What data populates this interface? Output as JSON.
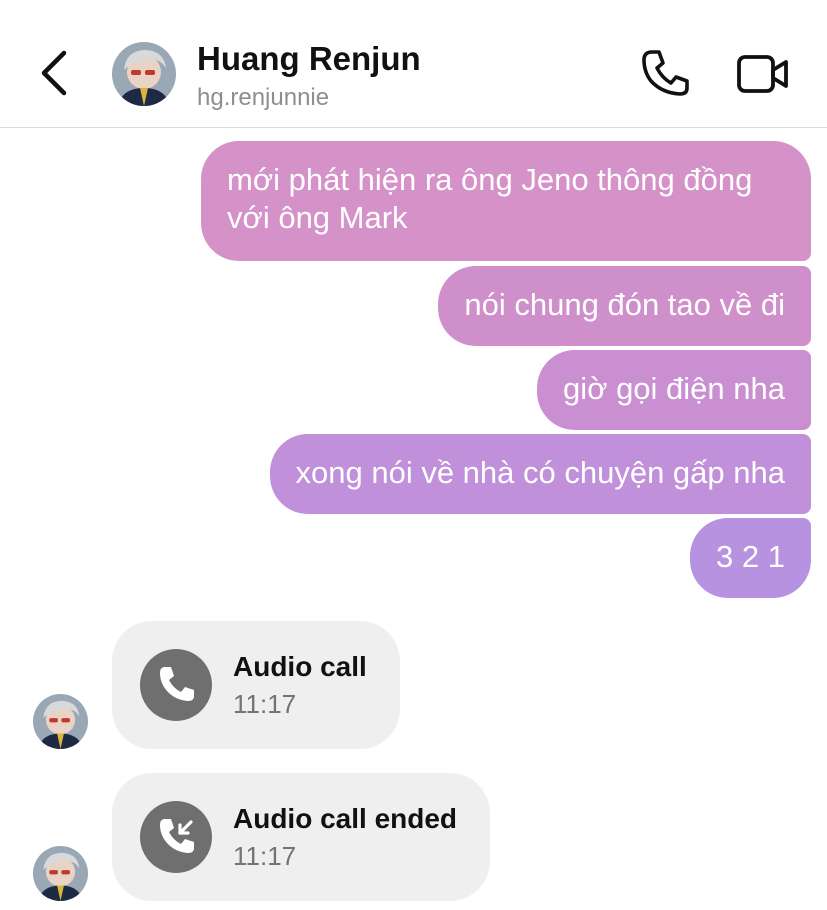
{
  "header": {
    "contact_name": "Huang Renjun",
    "contact_handle": "hg.renjunnie",
    "icons": {
      "back": "chevron-left-icon",
      "call": "phone-icon",
      "video": "video-camera-icon"
    }
  },
  "messages": {
    "outgoing": [
      {
        "line1": "mới phát hiện ra ông Jeno thông đồng",
        "line2": "với ông Mark"
      },
      {
        "text": "nói chung đón tao về đi"
      },
      {
        "text": "giờ gọi điện nha"
      },
      {
        "text": "xong nói về nhà có chuyện gấp nha"
      },
      {
        "text": "3 2 1"
      }
    ],
    "calls": [
      {
        "title": "Audio call",
        "time": "11:17",
        "icon": "phone-icon"
      },
      {
        "title": "Audio call ended",
        "time": "11:17",
        "icon": "phone-incoming-arrow-icon"
      }
    ]
  },
  "colors": {
    "bubble_gradient_top": "#d592c8",
    "bubble_gradient_bottom": "#b792e0",
    "call_bubble": "#efefef",
    "call_icon_circle": "#6f6f6f",
    "divider": "#dbdbdb",
    "secondary_text": "#8e8e8e"
  }
}
